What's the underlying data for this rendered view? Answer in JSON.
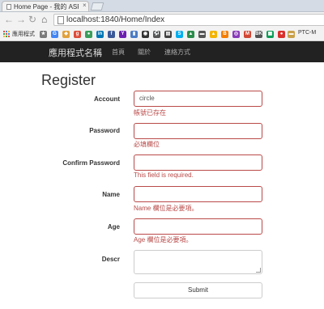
{
  "browser": {
    "tab_title": "Home Page - 我的 ASP.N",
    "tab_close": "×",
    "url": "localhost:1840/Home/Index"
  },
  "bookmarks": {
    "apps_label": "應用程式",
    "items": [
      {
        "icon": "star-icon",
        "letter": "★",
        "color": "#7a7a7a"
      },
      {
        "icon": "google-icon",
        "letter": "G",
        "color": "#4285f4"
      },
      {
        "icon": "photos-icon",
        "letter": "◆",
        "color": "#e2a13b"
      },
      {
        "icon": "google-plus-icon",
        "letter": "g",
        "color": "#dd4b39"
      },
      {
        "icon": "picasa-icon",
        "letter": "●",
        "color": "#3a9e5a"
      },
      {
        "icon": "linkedin-icon",
        "letter": "in",
        "color": "#0077b5"
      },
      {
        "icon": "facebook-icon",
        "letter": "f",
        "color": "#3b5998"
      },
      {
        "icon": "yahoo-icon",
        "letter": "Y",
        "color": "#6b1fb1"
      },
      {
        "icon": "dashboard-icon",
        "letter": "▮",
        "color": "#4b7cc4"
      },
      {
        "icon": "github-icon",
        "letter": "◉",
        "color": "#333"
      },
      {
        "icon": "soccer-icon",
        "letter": "⚽",
        "color": "#555"
      },
      {
        "icon": "notes-icon",
        "letter": "▤",
        "color": "#444"
      },
      {
        "icon": "skype-icon",
        "letter": "S",
        "color": "#00aff0"
      },
      {
        "icon": "drive-icon",
        "letter": "▲",
        "color": "#2a8c4a"
      },
      {
        "icon": "wallet-icon",
        "letter": "▬",
        "color": "#555"
      },
      {
        "icon": "google-drive-icon",
        "letter": "▲",
        "color": "#f4b400"
      },
      {
        "icon": "blogger-icon",
        "letter": "B",
        "color": "#f57d00"
      },
      {
        "icon": "instagram-icon",
        "letter": "◎",
        "color": "#8a3ab9"
      },
      {
        "icon": "gmail-icon",
        "letter": "M",
        "color": "#d14836"
      },
      {
        "icon": "bk-icon",
        "letter": "BK",
        "color": "#555"
      },
      {
        "icon": "sheets-icon",
        "letter": "▦",
        "color": "#0f9d58"
      },
      {
        "icon": "tomato-icon",
        "letter": "●",
        "color": "#d9302c"
      },
      {
        "icon": "folder-icon",
        "letter": "▬",
        "color": "#c9a14a"
      }
    ],
    "last_label": "PTC-M"
  },
  "site": {
    "brand": "應用程式名稱",
    "nav": [
      "首頁",
      "關於",
      "連絡方式"
    ]
  },
  "form": {
    "title": "Register",
    "fields": {
      "account": {
        "label": "Account",
        "value": "circle",
        "error": "帳號已存在"
      },
      "password": {
        "label": "Password",
        "value": "",
        "error": "必填欄位"
      },
      "confirm": {
        "label": "Confirm Password",
        "value": "",
        "error": "This field is required."
      },
      "name": {
        "label": "Name",
        "value": "",
        "error": "Name 欄位是必要項。"
      },
      "age": {
        "label": "Age",
        "value": "",
        "error": "Age 欄位是必要項。"
      },
      "descr": {
        "label": "Descr",
        "value": ""
      }
    },
    "submit_label": "Submit"
  },
  "colors": {
    "error": "#b94a48",
    "navbar": "#222222"
  }
}
